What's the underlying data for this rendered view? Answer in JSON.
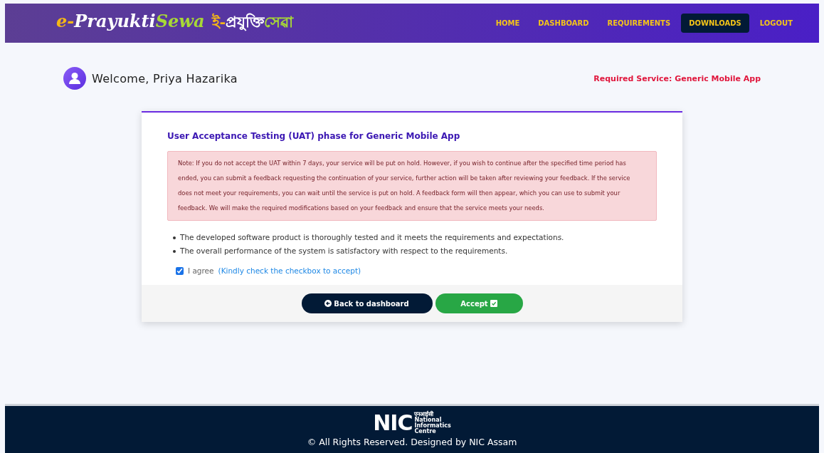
{
  "logo": {
    "parts": [
      {
        "text": "e-",
        "kind": "accent"
      },
      {
        "text": "Prayukti",
        "kind": "light"
      },
      {
        "text": "Sewa",
        "kind": "green"
      },
      {
        "text": "ই-",
        "kind": "accent"
      },
      {
        "text": "প্রযুক্তি",
        "kind": "light"
      },
      {
        "text": "সেৱা",
        "kind": "green"
      }
    ]
  },
  "nav": [
    {
      "label": "HOME",
      "selected": false
    },
    {
      "label": "DASHBOARD",
      "selected": false
    },
    {
      "label": "REQUIREMENTS",
      "selected": false
    },
    {
      "label": "DOWNLOADS",
      "selected": true
    },
    {
      "label": "LOGOUT",
      "selected": false
    }
  ],
  "welcome": "Welcome, Priya Hazarika",
  "required_service": "Required Service: Generic Mobile App",
  "card": {
    "title": "User Acceptance Testing (UAT) phase for Generic Mobile App",
    "note": "Note: If you do not accept the UAT within 7 days, your service will be put on hold. However, if you wish to continue after the specified time period has ended, you can submit a feedback requesting the continuation of your service, further action will be taken after reviewing your feedback. If the service does not meet your requirements, you can wait until the service is put on hold. A feedback form will then appear, which you can use to submit your feedback. We will make the required modifications based on your feedback and ensure that the service meets your needs.",
    "points": [
      "The developed software product is thoroughly tested and it meets the requirements and expectations.",
      "The overall performance of the system is satisfactory with respect to the requirements."
    ],
    "agree": {
      "label": "I agree",
      "hint": "(Kindly check the checkbox to accept)",
      "checked": true
    },
    "buttons": [
      {
        "label": "Back to dashboard",
        "kind": "back"
      },
      {
        "label": "Accept",
        "kind": "accept"
      }
    ]
  },
  "footer": {
    "logo_letters": "NIC",
    "logo_hindi": "एनआईसी",
    "logo_lines": [
      "National",
      "Informatics",
      "Centre"
    ],
    "copyright": "© All Rights Reserved. Designed by NIC Assam"
  }
}
